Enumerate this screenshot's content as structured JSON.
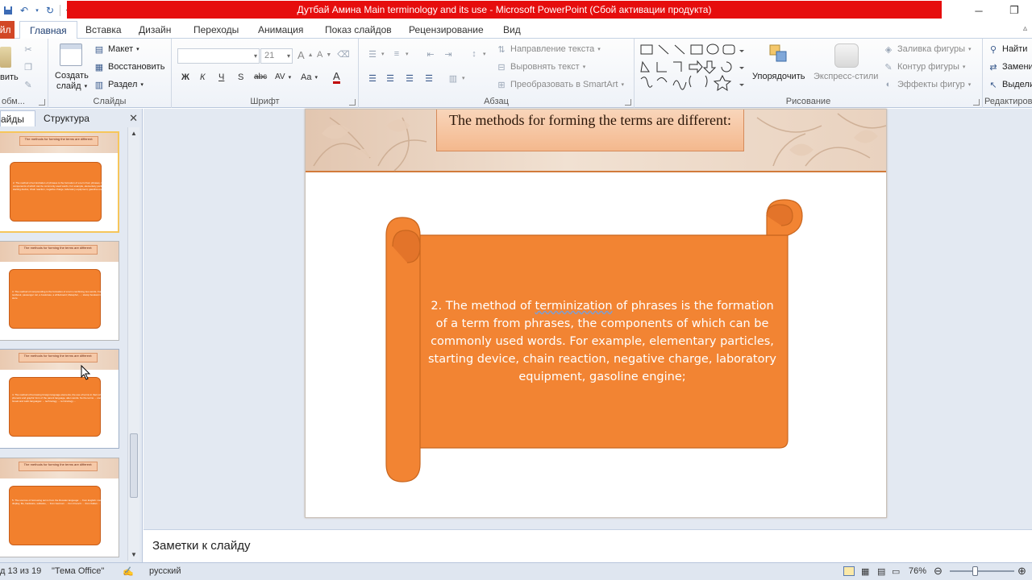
{
  "window": {
    "title": "Дутбай Амина Main terminology and its use  -  Microsoft PowerPoint (Сбой активации продукта)",
    "minimize_icon": "minimize-icon",
    "restore_icon": "restore-icon",
    "title_color": "#e60d0d"
  },
  "tabs": {
    "file": "Файл",
    "items": [
      "Главная",
      "Вставка",
      "Дизайн",
      "Переходы",
      "Анимация",
      "Показ слайдов",
      "Рецензирование",
      "Вид"
    ],
    "active": "Главная"
  },
  "ribbon": {
    "clipboard": {
      "paste_partial": "вить",
      "label": "обм..."
    },
    "slides": {
      "create_line1": "Создать",
      "create_line2": "слайд",
      "layout": "Макет",
      "reset": "Восстановить",
      "section": "Раздел",
      "label": "Слайды"
    },
    "font": {
      "size": "21",
      "label": "Шрифт",
      "bold": "Ж",
      "italic": "К",
      "underline": "Ч",
      "strike": "S",
      "shadow": "abc",
      "spacing": "AV",
      "case": "Aa",
      "grow": "A",
      "shrink": "A",
      "color": "A"
    },
    "paragraph": {
      "direction": "Направление текста",
      "align": "Выровнять текст",
      "smartart": "Преобразовать в SmartArt",
      "label": "Абзац"
    },
    "drawing": {
      "arrange": "Упорядочить",
      "express": "Экспресс-стили",
      "fill": "Заливка фигуры",
      "outline": "Контур фигуры",
      "effects": "Эффекты фигур",
      "label": "Рисование"
    },
    "editing": {
      "find": "Найти",
      "replace": "Замени",
      "select": "Выдели",
      "label": "Редактиров"
    }
  },
  "left_pane": {
    "tab_slides": "айды",
    "tab_outline": "Структура",
    "thumbnails": [
      {
        "title": "The methods for forming the terms are different:",
        "body": "2. The method of terminization of phrases is the formation of a term from phrases, the components of which can be commonly used words. For example, elementary particles, starting device, chain reaction, negative charge, laboratory equipment, gasoline engine;"
      },
      {
        "title": "The methods for forming the terms are different:",
        "body": "3. The method of compounding is the formation of a term combining two words. For example: a textbook, passenger car, a bookcase, a whiteboard; Metaphor, ...; stamp bookworm, chain store"
      },
      {
        "title": "The methods for forming the terms are different:",
        "body": "4. The method of borrowing foreign language elements, the use of terms in their original phonetic and graphic form of the parent language, alien words. So the terms ... come from the Greek and Latin languages: ... technology, ... terminology ..."
      },
      {
        "title": "The methods for forming the terms are different:",
        "body": "5. The sources of borrowing terms from the Russian language: ... from English: computer, display, file, hardware, software, ... from German: ... from French: ... from Italian: ..."
      }
    ]
  },
  "slide": {
    "title": "The methods for forming the terms are different:",
    "scroll_text_before": "2. The method of ",
    "scroll_text_marked": "terminization",
    "scroll_text_after": " of phrases is the formation of a term from phrases, the components of which can be commonly used words.  For example, elementary particles, starting device, chain reaction, negative charge, laboratory equipment,  gasoline engine;",
    "scroll_color": "#f28433"
  },
  "notes": {
    "placeholder": "Заметки к слайду"
  },
  "status": {
    "slide_counter": "д 13 из 19",
    "theme": "\"Тема Office\"",
    "language": "русский",
    "zoom": "76%",
    "zoom_level": 76
  }
}
